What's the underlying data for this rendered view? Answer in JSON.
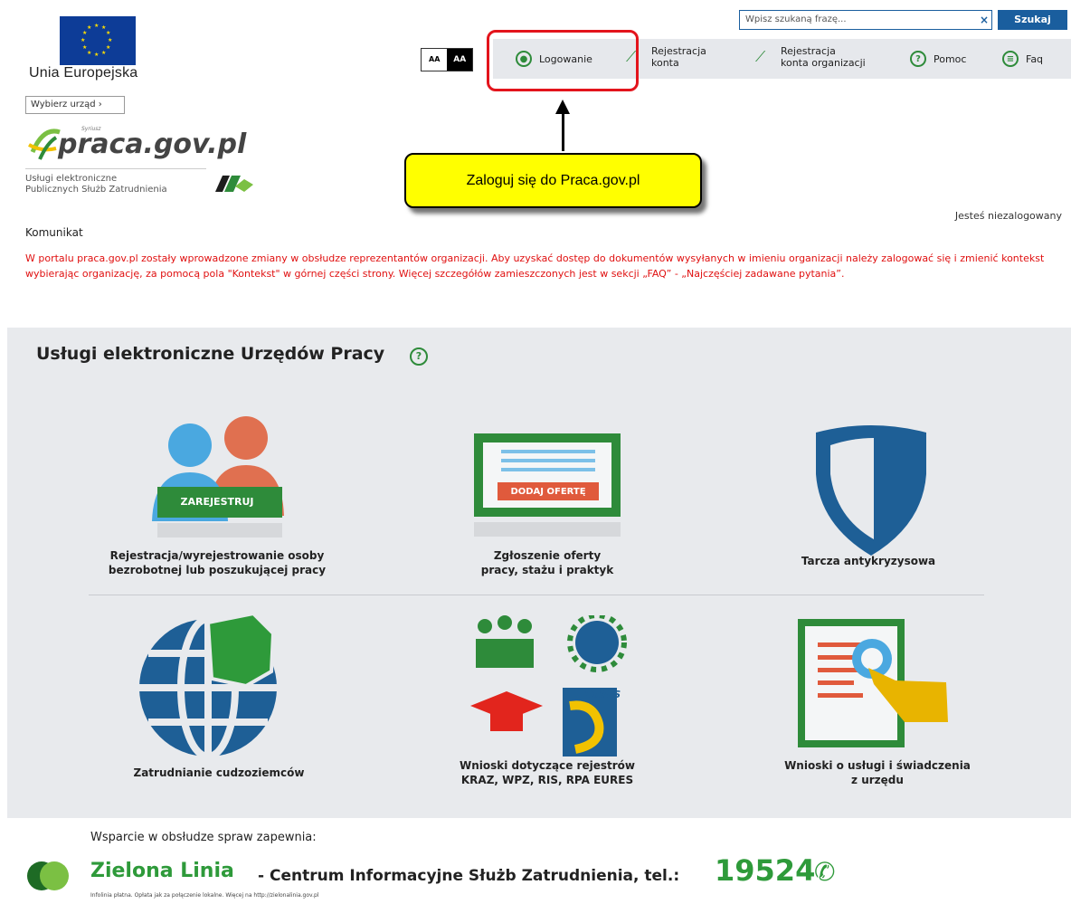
{
  "header": {
    "eu_label": "Unia Europejska",
    "choose_office": "Wybierz urząd ›",
    "praca_small": "Syriusz",
    "praca_logo": "praca.gov.pl",
    "services_line1": "Usługi elektroniczne",
    "services_line2": "Publicznych Służb Zatrudnienia",
    "search_placeholder": "Wpisz szukaną frazę...",
    "search_clear": "×",
    "search_button": "Szukaj",
    "font_small": "AA",
    "font_large": "AA"
  },
  "nav": {
    "login": "Logowanie",
    "register_line1": "Rejestracja",
    "register_line2": "konta",
    "register_org_line1": "Rejestracja",
    "register_org_line2": "konta organizacji",
    "help": "Pomoc",
    "faq": "Faq"
  },
  "callout": {
    "text": "Zaloguj się do Praca.gov.pl"
  },
  "status": {
    "logged": "Jesteś niezalogowany"
  },
  "message": {
    "heading": "Komunikat",
    "body": "W portalu praca.gov.pl zostały wprowadzone zmiany w obsłudze reprezentantów organizacji. Aby uzyskać dostęp do dokumentów wysyłanych w imieniu organizacji należy zalogować się i zmienić kontekst wybierając organizację, za pomocą pola \"Kontekst\" w górnej części strony. Więcej szczegółów zamieszczonych jest w sekcji „FAQ” - „Najczęściej zadawane pytania”."
  },
  "services": {
    "title": "Usługi elektroniczne Urzędów Pracy",
    "help_glyph": "?",
    "register_badge": "ZAREJESTRUJ",
    "offer_badge": "DODAJ OFERTĘ",
    "eures_label": "EURES",
    "tiles": [
      {
        "line1": "Rejestracja/wyrejestrowanie osoby",
        "line2": "bezrobotnej lub poszukującej pracy"
      },
      {
        "line1": "Zgłoszenie oferty",
        "line2": "pracy, stażu i praktyk"
      },
      {
        "line1": "Tarcza antykryzysowa",
        "line2": ""
      },
      {
        "line1": "Zatrudnianie cudzoziemców",
        "line2": ""
      },
      {
        "line1": "Wnioski dotyczące rejestrów",
        "line2": "KRAZ, WPZ, RIS, RPA EURES"
      },
      {
        "line1": "Wnioski o usługi i świadczenia",
        "line2": "z urzędu"
      }
    ]
  },
  "footer": {
    "support": "Wsparcie w obsłudze spraw zapewnia:",
    "title": "Zielona Linia",
    "subtitle": "- Centrum Informacyjne Służb Zatrudnienia, tel.:",
    "number": "19524",
    "note": "Infolinia płatna. Opłata jak za połączenie lokalne. Więcej na http://zielonalinia.gov.pl"
  },
  "colors": {
    "accent_blue": "#1a5e9e",
    "brand_green": "#2e8b3a",
    "highlight_red": "#e3141c",
    "callout_yellow": "#ffff00",
    "message_red": "#e01010"
  }
}
